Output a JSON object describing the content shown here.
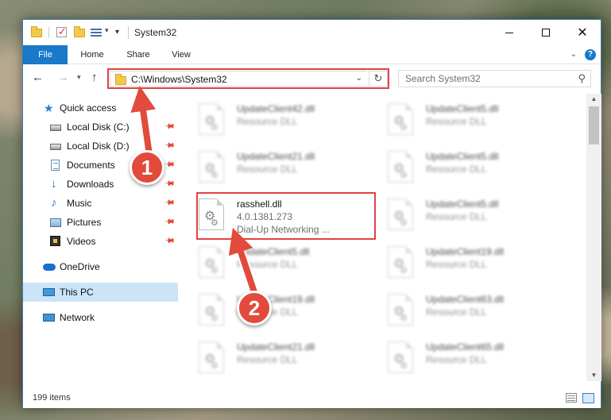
{
  "window": {
    "title": "System32"
  },
  "ribbon": {
    "tabs": [
      "File",
      "Home",
      "Share",
      "View"
    ],
    "help": "?"
  },
  "nav": {
    "address_path": "C:\\Windows\\System32",
    "search_placeholder": "Search System32"
  },
  "sidebar": {
    "items": [
      {
        "label": "Quick access",
        "icon": "star-icon"
      },
      {
        "label": "Local Disk (C:)",
        "icon": "disk-icon",
        "pinned": true
      },
      {
        "label": "Local Disk (D:)",
        "icon": "disk-icon",
        "pinned": true
      },
      {
        "label": "Documents",
        "icon": "documents-icon",
        "pinned": true
      },
      {
        "label": "Downloads",
        "icon": "download-icon",
        "pinned": true
      },
      {
        "label": "Music",
        "icon": "music-icon",
        "pinned": true
      },
      {
        "label": "Pictures",
        "icon": "pictures-icon",
        "pinned": true
      },
      {
        "label": "Videos",
        "icon": "videos-icon",
        "pinned": true
      },
      {
        "label": "OneDrive",
        "icon": "cloud-icon"
      },
      {
        "label": "This PC",
        "icon": "pc-icon",
        "selected": true
      },
      {
        "label": "Network",
        "icon": "network-icon"
      }
    ]
  },
  "files": {
    "left": [
      {
        "name": "UpdateClient42.dll",
        "desc": "Resource DLL"
      },
      {
        "name": "UpdateClient21.dll",
        "desc": "Resource DLL"
      },
      {
        "name": "rasshell.dll",
        "desc": "4.0.1381.273",
        "desc2": "Dial-Up Networking ..."
      },
      {
        "name": "UpdateClient5.dll",
        "desc": "Resource DLL"
      },
      {
        "name": "UpdateClient19.dll",
        "desc": "Resource DLL"
      },
      {
        "name": "UpdateClient21.dll",
        "desc": "Resource DLL"
      }
    ],
    "right": [
      {
        "name": "UpdateClient5.dll",
        "desc": "Resource DLL"
      },
      {
        "name": "UpdateClient5.dll",
        "desc": "Resource DLL"
      },
      {
        "name": "UpdateClient5.dll",
        "desc": "Resource DLL"
      },
      {
        "name": "UpdateClient19.dll",
        "desc": "Resource DLL"
      },
      {
        "name": "UpdateClient63.dll",
        "desc": "Resource DLL"
      },
      {
        "name": "UpdateClient65.dll",
        "desc": "Resource DLL"
      }
    ]
  },
  "status": {
    "item_count": "199 items"
  },
  "annotations": {
    "callout_1": "1",
    "callout_2": "2",
    "color": "#e24a3c"
  }
}
